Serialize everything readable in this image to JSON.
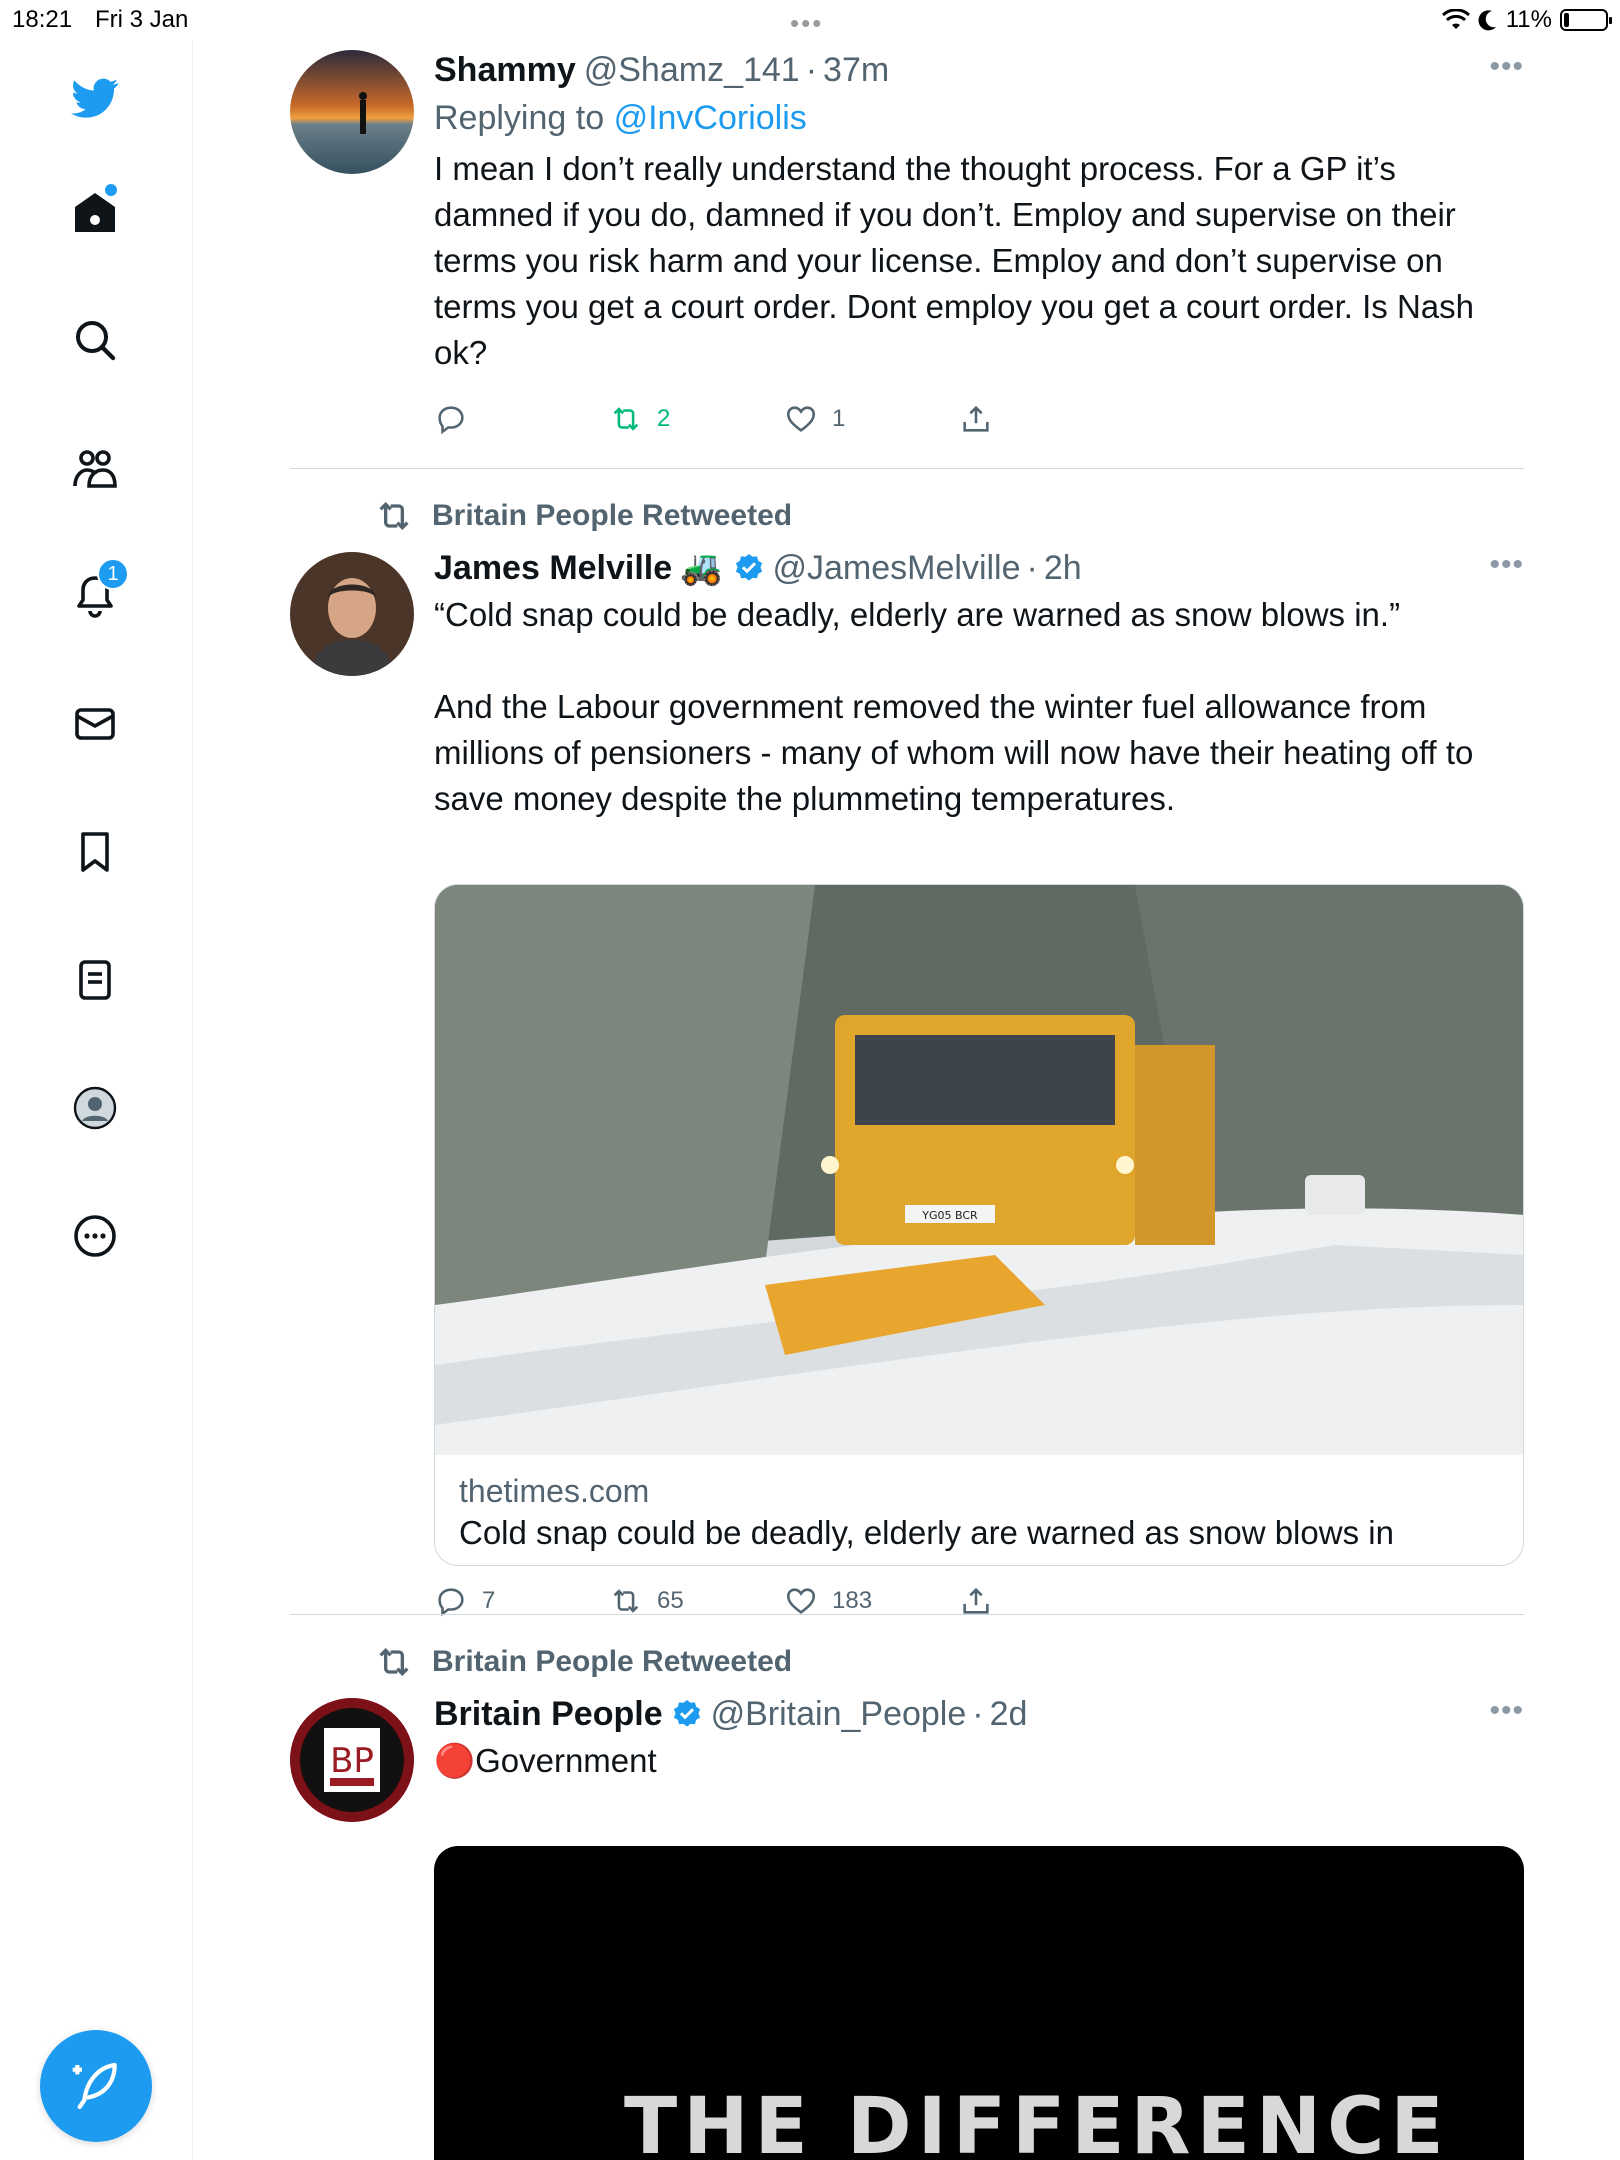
{
  "status_bar": {
    "time": "18:21",
    "date": "Fri 3 Jan",
    "battery": "11%"
  },
  "sidebar": {
    "notifications_badge": "1",
    "items": [
      "twitter-logo",
      "home-icon",
      "search-icon",
      "communities-icon",
      "notifications-icon",
      "messages-icon",
      "bookmarks-icon",
      "lists-icon",
      "profile-icon",
      "more-icon"
    ]
  },
  "colors": {
    "accent": "#1d9bf0",
    "retweet_green": "#00ba7c",
    "muted": "#536471"
  },
  "tweets": [
    {
      "name": "Shammy",
      "handle": "@Shamz_141",
      "time": "37m",
      "replying_label": "Replying to",
      "replying_to": "@InvCoriolis",
      "text": "I mean I don’t really understand the thought process. For a GP it’s damned if you do, damned if you don’t. Employ and supervise on their terms you risk harm and your license. Employ and don’t supervise on terms you get a court order. Dont employ you get a court order. Is Nash ok?",
      "replies": "",
      "retweets": "2",
      "likes": "1"
    },
    {
      "retweeted_by": "Britain People Retweeted",
      "name": "James Melville",
      "name_emoji": "🚜",
      "handle": "@JamesMelville",
      "time": "2h",
      "text": "“Cold snap could be deadly, elderly are warned as snow blows in.”\n\nAnd the Labour government removed the winter fuel allowance from millions of pensioners - many of whom will now have their heating off to save money despite the plummeting temperatures.",
      "card_domain": "thetimes.com",
      "card_title": "Cold snap could be deadly, elderly are warned as snow blows in",
      "card_plate": "YG05 BCR",
      "replies": "7",
      "retweets": "65",
      "likes": "183"
    },
    {
      "retweeted_by": "Britain People Retweeted",
      "name": "Britain People",
      "handle": "@Britain_People",
      "time": "2d",
      "text": "🔴Government",
      "avatar_text": "BP",
      "media_text": "THE DIFFERENCE"
    }
  ]
}
